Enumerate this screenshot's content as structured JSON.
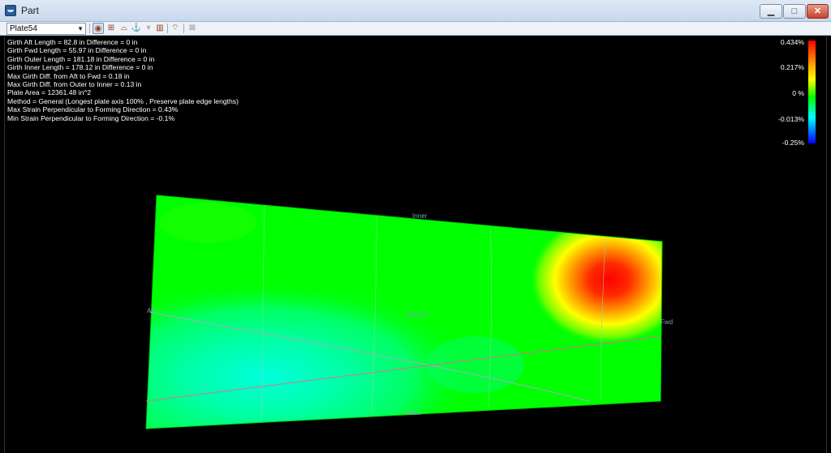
{
  "window": {
    "title": "Part",
    "min_label": "▁",
    "max_label": "□",
    "close_label": "✕"
  },
  "toolbar": {
    "plate_select": "Plate54",
    "buttons": [
      "view-icon",
      "grid-icon",
      "shape-icon",
      "anchor-icon",
      "forming-icon",
      "roll-icon",
      "press-icon",
      "disabled-icon"
    ]
  },
  "info": {
    "lines": [
      "Girth Aft Length = 82.8 in Difference = 0 in",
      "Girth Fwd Length = 55.97 in Difference = 0 in",
      "Girth Outer Length = 181.18 in Difference = 0 in",
      "Girth Inner Length = 178.12 in Difference = 0 in",
      "Max Girth Diff. from Aft to Fwd = 0.18 in",
      "Max Girth Diff. from Outer to Inner = 0.13 in",
      "Plate Area = 12361.48 in^2",
      "Method = General (Longest plate axis 100% , Preserve plate edge lengths)",
      "Max Strain Perpendicular to Forming Direction = 0.43%",
      "Min Strain Perpendicular to Forming Direction = -0.1%"
    ]
  },
  "legend": {
    "labels": [
      "0.434%",
      "0.217%",
      "0 %",
      "-0.013%",
      "-0.25%"
    ],
    "colors": [
      "#ff0000",
      "#ff9900",
      "#ffff00",
      "#00ff00",
      "#00ffff",
      "#0000ff"
    ]
  },
  "plate": {
    "name": "Plate54",
    "edge_inner": "Inner",
    "edge_outer": "Outer",
    "edge_fwd": "Fwd",
    "edge_aft": "Aft"
  }
}
